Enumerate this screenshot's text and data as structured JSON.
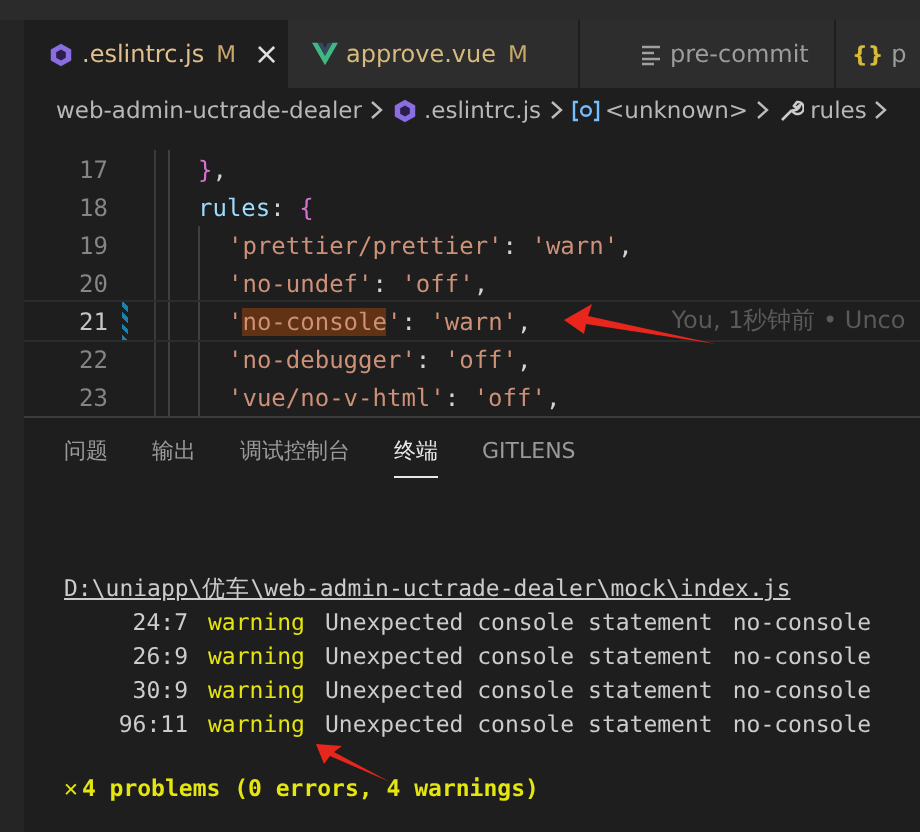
{
  "editor_tabs": [
    {
      "label": ".eslintrc.js",
      "kind": "eslint",
      "badge": "M",
      "close": "×",
      "selected": true
    },
    {
      "label": "approve.vue",
      "kind": "vue",
      "badge": "M",
      "selected": false
    },
    {
      "label": "pre-commit",
      "kind": "lines",
      "selected": false
    },
    {
      "label": "p",
      "kind": "braces",
      "icon_text": "{}",
      "selected": false
    }
  ],
  "breadcrumb": [
    {
      "label": "web-admin-uctrade-dealer",
      "kind": "folder"
    },
    {
      "label": ".eslintrc.js",
      "kind": "eslint"
    },
    {
      "label": "<unknown>",
      "kind": "symbol"
    },
    {
      "label": "rules",
      "kind": "property"
    }
  ],
  "code_lines": [
    {
      "number": "17",
      "current": false,
      "modified": false,
      "tokens": [
        {
          "text": "}",
          "kind": "bracket"
        },
        {
          "text": ",",
          "kind": "punct"
        }
      ]
    },
    {
      "number": "18",
      "current": false,
      "modified": false,
      "tokens": [
        {
          "text": "rules",
          "kind": "key"
        },
        {
          "text": ": ",
          "kind": "punct"
        },
        {
          "text": "{",
          "kind": "bracket"
        }
      ],
      "children": [
        {
          "number": "19",
          "current": false,
          "modified": false,
          "tokens": [
            {
              "text": "'prettier/prettier'",
              "kind": "string"
            },
            {
              "text": ": ",
              "kind": "punct"
            },
            {
              "text": "'warn'",
              "kind": "string"
            },
            {
              "text": ",",
              "kind": "punct"
            }
          ]
        },
        {
          "number": "20",
          "current": false,
          "modified": false,
          "tokens": [
            {
              "text": "'no-undef'",
              "kind": "string"
            },
            {
              "text": ": ",
              "kind": "punct"
            },
            {
              "text": "'off'",
              "kind": "string"
            },
            {
              "text": ",",
              "kind": "punct"
            }
          ]
        },
        {
          "number": "21",
          "current": true,
          "modified": true,
          "blame": "You, 1秒钟前 • Unco",
          "tokens": [
            {
              "text": "'",
              "kind": "string"
            },
            {
              "text": "no-console",
              "kind": "string",
              "match": true
            },
            {
              "text": "'",
              "kind": "string"
            },
            {
              "text": ": ",
              "kind": "punct"
            },
            {
              "text": "'warn'",
              "kind": "string"
            },
            {
              "text": ",",
              "kind": "punct"
            }
          ]
        },
        {
          "number": "22",
          "current": false,
          "modified": false,
          "tokens": [
            {
              "text": "'no-debugger'",
              "kind": "string"
            },
            {
              "text": ": ",
              "kind": "punct"
            },
            {
              "text": "'off'",
              "kind": "string"
            },
            {
              "text": ",",
              "kind": "punct"
            }
          ]
        },
        {
          "number": "23",
          "current": false,
          "modified": false,
          "tokens": [
            {
              "text": "'vue/no-v-html'",
              "kind": "string"
            },
            {
              "text": ": ",
              "kind": "punct"
            },
            {
              "text": "'off'",
              "kind": "string"
            },
            {
              "text": ",",
              "kind": "punct"
            }
          ]
        }
      ]
    }
  ],
  "panel_tabs": [
    {
      "label": "问题",
      "selected": false
    },
    {
      "label": "输出",
      "selected": false
    },
    {
      "label": "调试控制台",
      "selected": false
    },
    {
      "label": "终端",
      "selected": true
    },
    {
      "label": "GITLENS",
      "selected": false
    }
  ],
  "terminal": {
    "path": "D:\\uniapp\\优车\\web-admin-uctrade-dealer\\mock\\index.js",
    "rows": [
      {
        "location": "24:7",
        "severity": "warning",
        "message": "Unexpected console statement",
        "rule": "no-console"
      },
      {
        "location": "26:9",
        "severity": "warning",
        "message": "Unexpected console statement",
        "rule": "no-console"
      },
      {
        "location": "30:9",
        "severity": "warning",
        "message": "Unexpected console statement",
        "rule": "no-console"
      },
      {
        "location": "96:11",
        "severity": "warning",
        "message": "Unexpected console statement",
        "rule": "no-console"
      }
    ],
    "summary_icon": "✕",
    "summary": "4 problems (0 errors, 4 warnings)"
  }
}
